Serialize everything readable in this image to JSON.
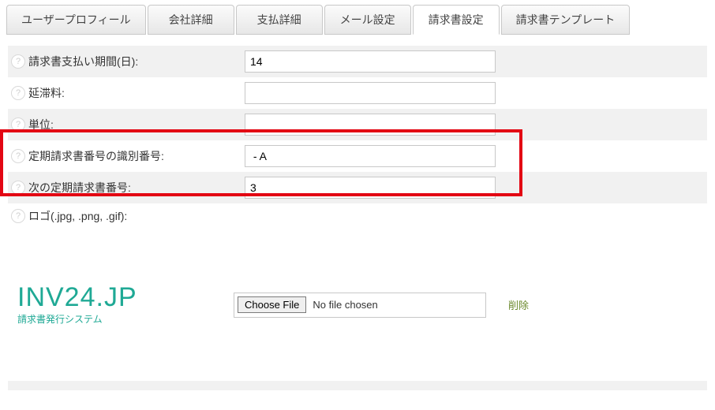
{
  "tabs": {
    "user_profile": "ユーザープロフィール",
    "company": "会社詳細",
    "payment": "支払詳細",
    "mail": "メール設定",
    "invoice": "請求書設定",
    "template": "請求書テンプレート"
  },
  "fields": {
    "payment_period": {
      "label": "請求書支払い期間(日):",
      "value": "14"
    },
    "late_fee": {
      "label": "延滞料:",
      "value": ""
    },
    "unit": {
      "label": "単位:",
      "value": ""
    },
    "recurring_id": {
      "label": "定期請求書番号の識別番号:",
      "value": " - A"
    },
    "next_recurring": {
      "label": "次の定期請求書番号:",
      "value": "3"
    },
    "logo": {
      "label": "ロゴ(.jpg, .png, .gif):"
    }
  },
  "logo": {
    "main": "INV24.JP",
    "sub": "請求書発行システム"
  },
  "file": {
    "button": "Choose File",
    "status": "No file chosen",
    "delete": "削除"
  },
  "help_glyph": "?"
}
